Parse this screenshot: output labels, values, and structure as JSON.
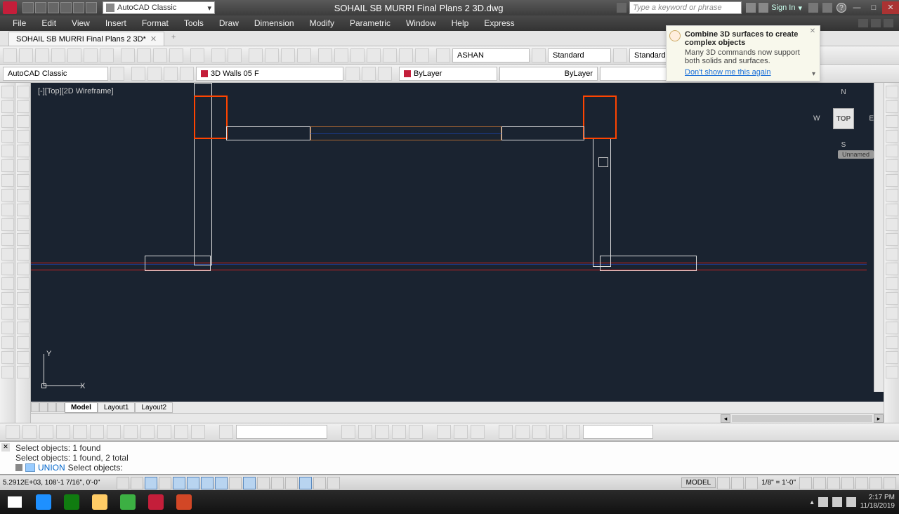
{
  "app": {
    "title": "SOHAIL SB MURRI  Final Plans 2 3D.dwg",
    "workspace": "AutoCAD Classic",
    "search_placeholder": "Type a keyword or phrase",
    "signin": "Sign In"
  },
  "menu": [
    "File",
    "Edit",
    "View",
    "Insert",
    "Format",
    "Tools",
    "Draw",
    "Dimension",
    "Modify",
    "Parametric",
    "Window",
    "Help",
    "Express"
  ],
  "doc_tab": "SOHAIL SB MURRI  Final Plans 2 3D*",
  "props": {
    "workspace": "AutoCAD Classic",
    "layer": "3D Walls 05 F",
    "linetype": "ByLayer",
    "lineweight": "ByLayer",
    "textstyle": "ASHAN",
    "dimstyle": "Standard",
    "tablestyle": "Standard"
  },
  "viewport": {
    "label": "[-][Top][2D Wireframe]",
    "cube": "TOP",
    "wcs": "Unnamed",
    "n": "N",
    "s": "S",
    "e": "E",
    "w": "W",
    "ucs_y": "Y",
    "ucs_x": "X"
  },
  "tabs": {
    "model": "Model",
    "l1": "Layout1",
    "l2": "Layout2"
  },
  "cmd": {
    "h1": "Select objects: 1 found",
    "h2": "Select objects: 1 found, 2 total",
    "prompt_cmd": "UNION",
    "prompt_text": "Select objects:"
  },
  "status": {
    "coords": "5.2912E+03,  108'-1 7/16\", 0'-0\"",
    "model": "MODEL",
    "scale": "1/8\" = 1'-0\""
  },
  "tip": {
    "title": "Combine 3D surfaces to create complex objects",
    "body": "Many 3D commands now support both solids and surfaces.",
    "link": "Don't show me this again"
  },
  "clock": {
    "time": "2:17 PM",
    "date": "11/18/2019"
  }
}
